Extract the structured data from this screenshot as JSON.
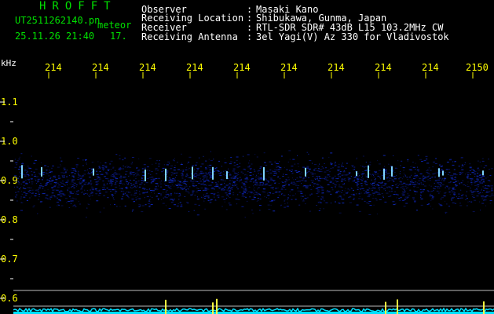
{
  "header": {
    "brand": "HROFFT",
    "filename": "UT2511262140.pn",
    "mode": "meteor",
    "datetime": "25.11.26 21:40",
    "number": "17.",
    "info": [
      {
        "label": "Observer",
        "sep": ":",
        "value": "Masaki Kano"
      },
      {
        "label": "Receiving Location",
        "sep": ":",
        "value": "Shibukawa, Gunma, Japan"
      },
      {
        "label": "Receiver",
        "sep": ":",
        "value": "RTL-SDR SDR# 43dB L15 103.2MHz CW"
      },
      {
        "label": "Receiving Antenna",
        "sep": ":",
        "value": "3el Yagi(V) Az 330 for Vladivostok"
      }
    ]
  },
  "axis": {
    "unit": "kHz",
    "time_ticks": [
      "214",
      "214",
      "214",
      "214",
      "214",
      "214",
      "214",
      "214",
      "214",
      "2150"
    ],
    "freq_ticks": [
      "1.1",
      "1.0",
      "0.9",
      "0.8",
      "0.7",
      "0.6"
    ]
  },
  "colors": {
    "background": "#000000",
    "label_green": "#00e000",
    "tick_yellow": "#ffff00",
    "signal_noise": "#0a1a8c",
    "meteor": "#7fd4ff",
    "level_cyan": "#00e0ff"
  }
}
